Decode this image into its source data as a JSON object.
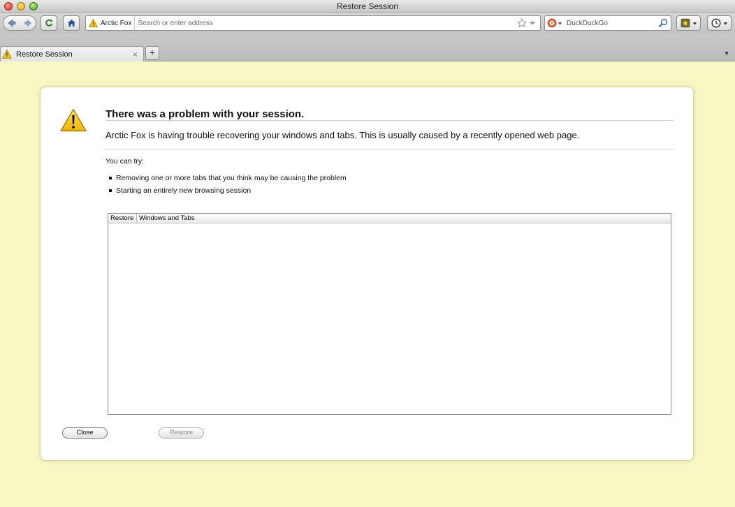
{
  "window": {
    "title": "Restore Session"
  },
  "toolbar": {
    "identity_label": "Arctic Fox",
    "url_placeholder": "Search or enter address",
    "search_engine": "DuckDuckGo",
    "search_placeholder": "DuckDuckGo"
  },
  "tabs": [
    {
      "label": "Restore Session",
      "close": "×",
      "active": true
    }
  ],
  "tabstrip": {
    "new_tab": "+",
    "list_all": "▼"
  },
  "page": {
    "heading": "There was a problem with your session.",
    "description": "Arctic Fox is having trouble recovering your windows and tabs. This is usually caused by a recently opened web page.",
    "you_can_try": "You can try:",
    "tips": [
      "Removing one or more tabs that you think may be causing the problem",
      "Starting an entirely new browsing session"
    ],
    "tree_columns": [
      "Restore",
      "Windows and Tabs"
    ],
    "close_button": "Close",
    "restore_button": "Restore"
  },
  "colors": {
    "page_background": "#f7f8c4",
    "warning_yellow": "#f5c400"
  }
}
